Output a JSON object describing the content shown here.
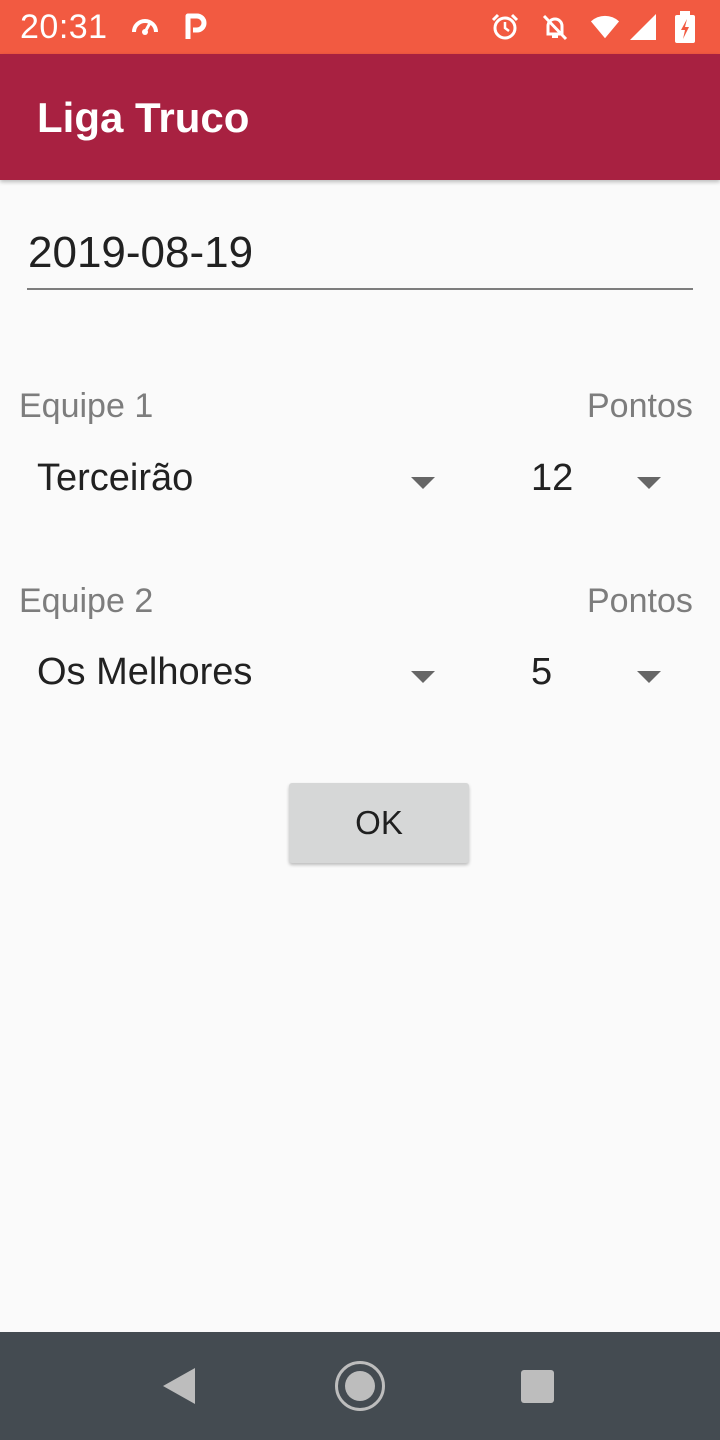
{
  "status_bar": {
    "time": "20:31",
    "icons": [
      "speedometer-icon",
      "parking-icon",
      "alarm-icon",
      "notifications-off-icon",
      "wifi-icon",
      "signal-icon",
      "battery-charging-icon"
    ]
  },
  "app_bar": {
    "title": "Liga Truco",
    "color": "#a82141"
  },
  "form": {
    "date": "2019-08-19",
    "team1": {
      "label": "Equipe 1",
      "points_label": "Pontos",
      "team_value": "Terceirão",
      "points_value": "12"
    },
    "team2": {
      "label": "Equipe 2",
      "points_label": "Pontos",
      "team_value": "Os Melhores",
      "points_value": "5"
    },
    "ok_label": "OK"
  },
  "nav_bar": {
    "buttons": [
      "back",
      "home",
      "recent-apps"
    ]
  },
  "colors": {
    "status_bar": "#f25a41",
    "app_bar": "#a82141",
    "background": "#fafafa",
    "nav_bar": "#444b51"
  }
}
